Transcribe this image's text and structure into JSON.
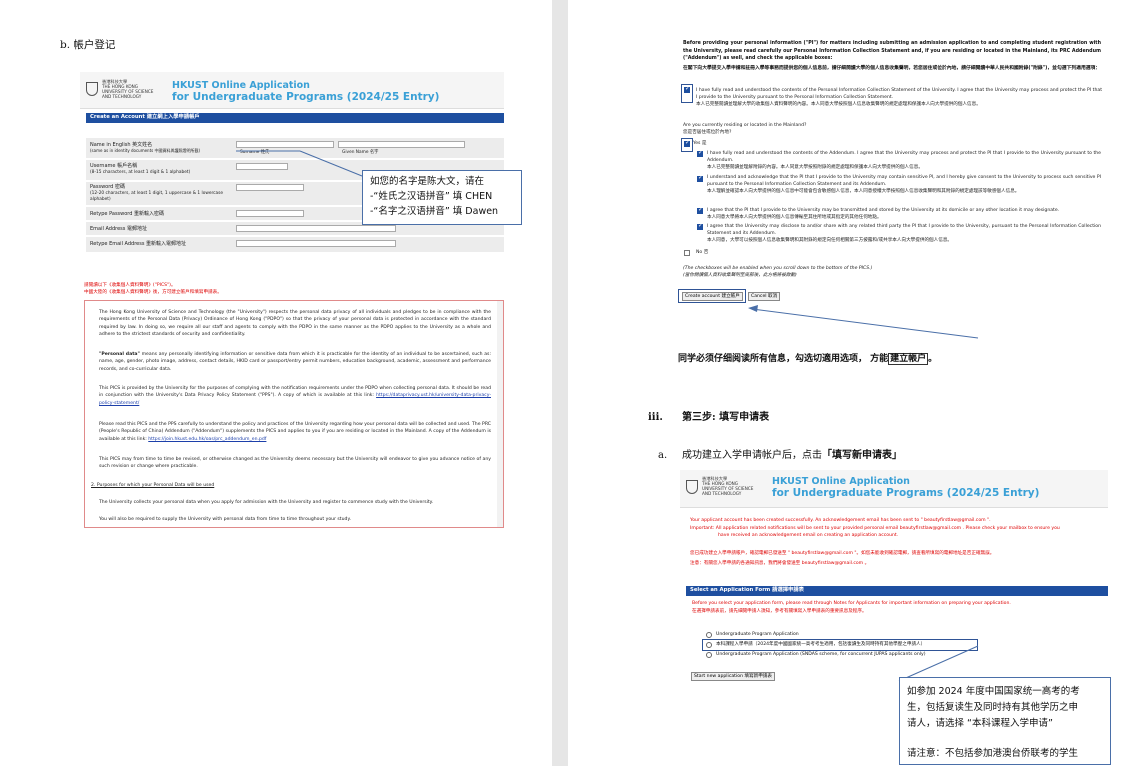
{
  "left": {
    "section_heading": "b.  帳户登记",
    "header": {
      "logo_lines": [
        "香港科技大學",
        "THE HONG KONG",
        "UNIVERSITY OF SCIENCE",
        "AND TECHNOLOGY"
      ],
      "title1": "HKUST Online Application",
      "title2": "for Undergraduate Programs (2024/25 Entry)"
    },
    "bar_title": "Create an Account 建立網上入學申請帳戶",
    "form": {
      "name_l1": "Name in English 英文姓名",
      "name_l2": "(same as in identity documents 中國資料與護照證明所載)",
      "surname": "Surname 姓氏",
      "given_name": "Given Name 名字",
      "user_l1": "Username 帳戶名稱",
      "user_l2": "(8-15 characters, at least 1 digit & 1 alphabet)",
      "pw_l1": "Password 密碼",
      "pw_l2": "(12-20 characters, at least 1 digit, 1 uppercase & 1 lowercase",
      "pw_l3": "alphabet)",
      "retype_pw": "Retype Password 重新輸入密碼",
      "email": "Email Address 電郵地址",
      "retype_email": "Retype Email Address 重新輸入電郵地址"
    },
    "callout": {
      "line1": "如您的名字是陈大文，请在",
      "line2": "-“姓氏之汉语拼音” 填 CHEN",
      "line3": "-“名字之汉语拼音” 填 Dawen"
    },
    "pics_intro": {
      "line1": "請閱讀以下《收集個人資料聲明》(\"PICS\")。",
      "line2": "中國大陸的《收集個人資料聲明》後，方可建立帳戶和填寫申請表。"
    },
    "pics": {
      "p1": "The Hong Kong University of Science and Technology (the \"University\") respects the personal data privacy of all individuals and pledges to be in compliance with the requirements of the Personal Data (Privacy) Ordinance of Hong Kong (\"PDPO\") so that the privacy of your personal data is protected in accordance with the standard required by law. In doing so, we require all our staff and agents to comply with the PDPO in the same manner as the PDPO applies to the University as a whole and adhere to the strictest standards of security and confidentiality.",
      "p2_bold": "\"Personal data\"",
      "p2_rest": " means any personally identifying information or sensitive data from which it is practicable for the identity of an individual to be ascertained, such as: name, age, gender, photo image, address, contact details, HKID card or passport/entry permit numbers, education background, academic, assessment and performance records, and co-curricular data.",
      "p3": "This PICS is provided by the University for the purposes of complying with the notification requirements under the PDPO when collecting personal data. It should be read in conjunction with the University's Data Privacy Policy Statement (\"PPS\"). A copy of which is available at this link:",
      "p3_link": "https://dataprivacy.ust.hk/university-data-privacy-policy-statement/",
      "p4": "Please read this PICS and the PPS carefully to understand the policy and practices of the University regarding how your personal data will be collected and used. The PRC (People's Republic of China) Addendum (\"Addendum\") supplements the PICS and applies to you if you are residing or located in the Mainland. A copy of the Addendum is available at this link:",
      "p4_link": "https://join.hkust.edu.hk/oas/prc_addendum_en.pdf",
      "p5": "This PICS may from time to time be revised, or otherwise changed as the University deems necessary but the University will endeavor to give you advance notice of any such revision or change where practicable.",
      "p6": "2.  Purposes for which your Personal Data will be used",
      "p7": "The University collects your personal data when you apply for admission with the University and register to commence study with the University.",
      "p8": "You will also be required to supply the University with personal data from time to time throughout your study."
    }
  },
  "right": {
    "intro_en": "Before providing your personal information (\"PI\") for matters including submitting an admission application to and completing student registration with the University, please read carefully our Personal Information Collection Statement and, if you are residing or located in the Mainland, its PRC Addendum (\"Addendum\") as well, and check the applicable boxes:",
    "intro_zh": "在閣下向大學提交入學申請和註冊入學等事務而提供您的個人信息前，請仔細閱讀大學的個人信息收集聲明，若您居住或位於內地，請仔細閱讀中華人民共和國附錄(\"附錄\")，並勾選下列適用選項：",
    "chk1_en": "I have fully read and understood the contents of the Personal Information Collection Statement of the University. I agree that the University may process and protect the PI that I provide to the University pursuant to the Personal Information Collection Statement.",
    "chk1_zh": "本人已完整閱讀並理解大學的收集個人資料聲明的內容。本人同意大學按照個人信息收集聲明的規定處理和保護本人向大學提供的個人信息。",
    "q_en": "Are you currently residing or located in the Mainland?",
    "q_zh": "您是否居住或位於內地?",
    "yes": "Yes 是",
    "chk2_en": "I have fully read and understood the contents of the Addendum. I agree that the University may process and protect the PI that I provide to the University pursuant to the Addendum.",
    "chk2_zh": "本人已完整閱讀並理解附錄的內容。本人同意大學按照附錄的規定處理和保護本人向大學提供的個人信息。",
    "chk3_en": "I understand and acknowledge that the PI that I provide to the University may contain sensitive PI, and I hereby give consent to the University to process such sensitive PI pursuant to the Personal Information Collection Statement and its Addendum.",
    "chk3_zh": "本人理解並確認本人向大學提供的個人信息中可能會包含敏感個人信息，本人同意授權大學按照個人信息收集聲明和其附錄的規定處理該等敏感個人信息。",
    "chk4_en": "I agree that the PI that I provide to the University may be transmitted and stored by the University at its domicile or any other location it may designate.",
    "chk4_zh": "本人同意大學將本人向大學提供的個人信息傳輸至其住所地或其指定的其他任何地點。",
    "chk5_en": "I agree that the University may disclose to and/or share with any related third party the PI that I provide to the University, pursuant to the Personal Information Collection Statement and its Addendum.",
    "chk5_zh": "本人同意，大學可以按照個人信息收集聲明和其附錄的規定向任何相關第三方披露和/或共享本人向大學提供的個人信息。",
    "no": "No 否",
    "enabled_en": "(The checkboxes will be enabled when you scroll down to the bottom of the PICS.)",
    "enabled_zh": "(當你閱讀個人資料收集聲明至底部後，此方格將被啟動)",
    "btn_create": "Create account 建立帳戶",
    "btn_cancel": "Cancel 取消",
    "instruction": "同学必须仔细阅读所有信息，勾选切適用选项， 方能",
    "instruction_hl": "建立帳户",
    "instruction_end": "。",
    "step_num": "iii.",
    "step_title": "第三步: 填写申请表",
    "sub_a_num": "a.",
    "sub_a_text": "成功建立入学申请帐户后，点击",
    "sub_a_bold": "「填写新申请表」",
    "header": {
      "logo_lines": [
        "香港科技大學",
        "THE HONG KONG",
        "UNIVERSITY OF SCIENCE",
        "AND TECHNOLOGY"
      ],
      "title1": "HKUST Online Application",
      "title2": "for Undergraduate Programs (2024/25 Entry)"
    },
    "msg1": "Your applicant account has been created successfully. An acknowledgement email has been sent to \" beautyfirstlaw@gmail.com \".",
    "msg2": "Important:  All application related notifications will be sent to your provided personal email beautyfirstlaw@gmail.com . Please check your mailbox to ensure you",
    "msg3": "have received an acknowledgement email on creating an application account.",
    "msg4": "您已成功建立入學申請帳戶，確認電郵已發送至 \" beautyfirstlaw@gmail.com \"。如您未能收到確認電郵，請查看所填寫的電郵地址是否正確無誤。",
    "msg5": "注意：有關您入學申請的各通知訊息，我們將會發送至 beautyfirstlaw@gmail.com 。",
    "select_bar": "Select an Application Form 請選擇申請表",
    "select_note": "Before you select your application form, please read through Notes for Applicants for important information on preparing your application.",
    "select_note_zh": "在選擇申請表前，請先細閱申請人須知，參考有關填寫入學申請表的重要訊息及程序。",
    "opt1": "Undergraduate Program Application",
    "opt2": "本科課程入學申請（2024年度中國國家統一高考考生適用，包括復讀生及同時持有其他學歷之申請人）",
    "opt3": "Undergraduate Program Application (SNDAS scheme, for concurrent JUPAS applicants only)",
    "btn_start": "Start new application 填寫新申請表",
    "callout": {
      "line1": "如参加 2024 年度中国国家统一高考的考",
      "line2": "生，包括复读生及同时持有其他学历之申",
      "line3": "请人，请选择 “本科课程入学申请”",
      "line4": "请注意：不包括参加港澳台侨联考的学生"
    }
  },
  "colors": {
    "blue_bar": "#1e4fa0",
    "title_blue": "#3aa0d6",
    "highlight_border": "#2f5496",
    "red_text": "#dd0000"
  }
}
